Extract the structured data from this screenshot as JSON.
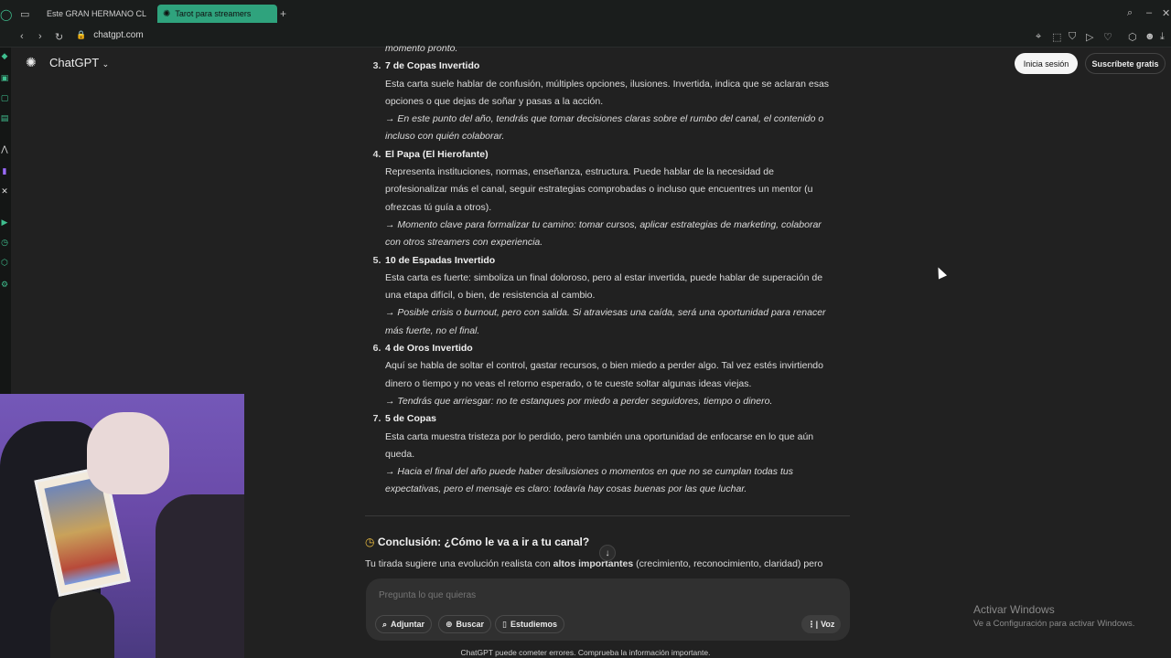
{
  "browser": {
    "tabs": [
      {
        "label": "Este GRAN HERMANO CL",
        "icon": "youtube-icon",
        "active": false
      },
      {
        "label": "Tarot para streamers",
        "icon": "chatgpt-icon",
        "active": true
      }
    ],
    "url": "chatgpt.com"
  },
  "app": {
    "name": "ChatGPT",
    "login_label": "Inicia sesión",
    "subscribe_label": "Suscríbete gratis"
  },
  "conversation": {
    "lead_line": "momento pronto.",
    "items": [
      {
        "num": "3.",
        "title": "7 de Copas Invertido",
        "lines": [
          "Esta carta suele hablar de confusión, múltiples opciones, ilusiones. Invertida, indica que se aclaran esas",
          "opciones o que dejas de soñar y pasas a la acción."
        ],
        "italic": [
          "→ En este punto del año, tendrás que tomar decisiones claras sobre el rumbo del canal, el contenido o",
          "incluso con quién colaborar."
        ]
      },
      {
        "num": "4.",
        "title": "El Papa (El Hierofante)",
        "lines": [
          "Representa instituciones, normas, enseñanza, estructura. Puede hablar de la necesidad de",
          "profesionalizar más el canal, seguir estrategias comprobadas o incluso que encuentres un mentor (u",
          "ofrezcas tú guía a otros)."
        ],
        "italic": [
          "→ Momento clave para formalizar tu camino: tomar cursos, aplicar estrategias de marketing, colaborar",
          "con otros streamers con experiencia."
        ]
      },
      {
        "num": "5.",
        "title": "10 de Espadas Invertido",
        "lines": [
          "Esta carta es fuerte: simboliza un final doloroso, pero al estar invertida, puede hablar de superación de",
          "una etapa difícil, o bien, de resistencia al cambio."
        ],
        "italic": [
          "→ Posible crisis o burnout, pero con salida. Si atraviesas una caída, será una oportunidad para renacer",
          "más fuerte, no el final."
        ]
      },
      {
        "num": "6.",
        "title": "4 de Oros Invertido",
        "lines": [
          "Aquí se habla de soltar el control, gastar recursos, o bien miedo a perder algo. Tal vez estés invirtiendo",
          "dinero o tiempo y no veas el retorno esperado, o te cueste soltar algunas ideas viejas."
        ],
        "italic": [
          "→ Tendrás que arriesgar: no te estanques por miedo a perder seguidores, tiempo o dinero."
        ]
      },
      {
        "num": "7.",
        "title": "5 de Copas",
        "lines": [
          "Esta carta muestra tristeza por lo perdido, pero también una oportunidad de enfocarse en lo que aún",
          "queda."
        ],
        "italic": [
          "→ Hacia el final del año puede haber desilusiones o momentos en que no se cumplan todas tus",
          "expectativas, pero el mensaje es claro: todavía hay cosas buenas por las que luchar."
        ]
      }
    ],
    "conclusion_title": "Conclusión: ¿Cómo le va a ir a tu canal?",
    "conclusion_pre": "Tu tirada sugiere una evolución realista con ",
    "conclusion_bold": "altos importantes",
    "conclusion_post": " (crecimiento, reconocimiento, claridad) pero"
  },
  "composer": {
    "placeholder": "Pregunta lo que quieras",
    "attach": "Adjuntar",
    "search": "Buscar",
    "study": "Estudiemos",
    "voice": "Voz"
  },
  "disclaimer": "ChatGPT puede cometer errores. Comprueba la información importante.",
  "watermark": {
    "title": "Activar Windows",
    "subtitle": "Ve a Configuración para activar Windows."
  },
  "colors": {
    "background": "#212121",
    "active_tab": "#2fa37d",
    "composer": "#303030"
  }
}
